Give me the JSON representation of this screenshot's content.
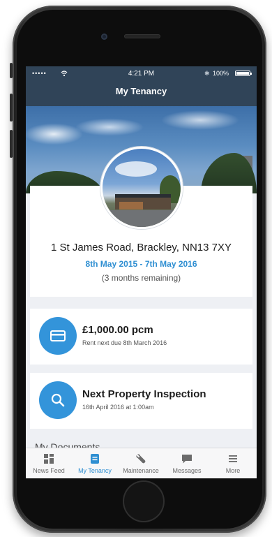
{
  "status_bar": {
    "signal": "•••••",
    "time": "4:21 PM",
    "battery": "100%"
  },
  "nav": {
    "title": "My Tenancy"
  },
  "property": {
    "address": "1 St James Road, Brackley, NN13 7XY",
    "dates": "8th May 2015 - 7th May 2016",
    "remaining": "(3 months remaining)"
  },
  "rent": {
    "amount": "£1,000.00 pcm",
    "due": "Rent next due 8th March 2016",
    "icon": "card-icon"
  },
  "inspection": {
    "title": "Next Property Inspection",
    "date": "16th April 2016 at 1:00am",
    "icon": "search-icon"
  },
  "documents": {
    "heading": "My Documents"
  },
  "tabs": [
    {
      "label": "News Feed",
      "icon": "news-feed-icon"
    },
    {
      "label": "My Tenancy",
      "icon": "tenancy-icon"
    },
    {
      "label": "Maintenance",
      "icon": "wrench-icon"
    },
    {
      "label": "Messages",
      "icon": "messages-icon"
    },
    {
      "label": "More",
      "icon": "menu-icon"
    }
  ],
  "colors": {
    "nav_bar": "#304458",
    "accent": "#2f8fd2",
    "icon_circle": "#3394da"
  }
}
